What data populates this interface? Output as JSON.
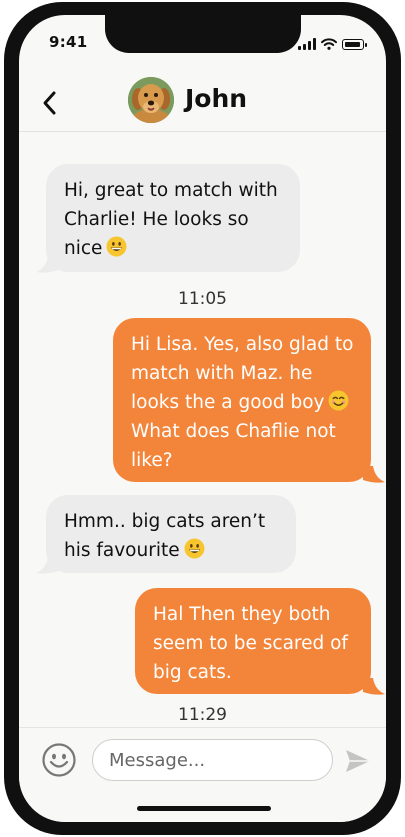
{
  "status_bar": {
    "time": "9:41"
  },
  "header": {
    "contact_name": "John",
    "back_icon": "chevron-left-icon",
    "avatar_icon": "dog-photo-avatar"
  },
  "messages": [
    {
      "direction": "incoming",
      "lines": [
        "Hi, great to match with",
        "Charlie! He looks so",
        "nice"
      ],
      "emoji": "grinning-face"
    },
    {
      "direction": "outgoing",
      "lines": [
        "Hi Lisa. Yes, also glad to",
        "match with Maz. he",
        "looks the a good boy",
        "What does Chaflie not",
        "like?"
      ],
      "emoji": "smiling-face"
    },
    {
      "direction": "incoming",
      "lines": [
        "Hmm.. big cats aren’t",
        "his favourite"
      ],
      "emoji": "grinning-face"
    },
    {
      "direction": "outgoing",
      "lines": [
        "Hal Then they both",
        "seem to be scared of",
        "big cats."
      ]
    }
  ],
  "timestamps": [
    "11:05",
    "11:29"
  ],
  "composer": {
    "placeholder": "Message...",
    "value": "",
    "emoji_icon": "smiley-icon",
    "send_icon": "send-arrow-icon"
  },
  "colors": {
    "outgoing_bubble": "#f3853a",
    "incoming_bubble": "#ececec",
    "background": "#f8f8f6",
    "phone_frame": "#101010"
  }
}
